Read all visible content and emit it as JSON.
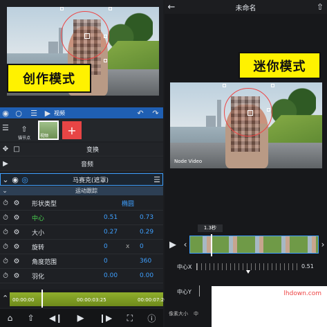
{
  "left": {
    "mode_label": "创作模式",
    "layer_bar": {
      "label": "视频"
    },
    "track": {
      "node_label": "锚节点",
      "clip_label": "视频",
      "add_label": "+"
    },
    "menu": {
      "transform": "变换",
      "audio": "音频"
    },
    "effect": {
      "title": "马赛克(遮罩)",
      "section": "运动跟踪"
    },
    "params": [
      {
        "name": "形状类型",
        "v1": "",
        "v2": "椭圆",
        "highlight": false
      },
      {
        "name": "中心",
        "v1": "0.51",
        "v2": "0.73",
        "highlight": true
      },
      {
        "name": "大小",
        "v1": "0.27",
        "v2": "0.29",
        "highlight": false
      },
      {
        "name": "旋转",
        "v1": "0",
        "mid": "x",
        "v2": "0",
        "highlight": false
      },
      {
        "name": "角度范围",
        "v1": "0",
        "v2": "360",
        "highlight": false
      },
      {
        "name": "羽化",
        "v1": "0.00",
        "v2": "0.00",
        "highlight": false
      }
    ],
    "timeline": {
      "t0": "00:00:00",
      "t1": "00:00:03:25",
      "t2": "00:00:07:20"
    }
  },
  "right": {
    "title": "未命名",
    "mode_label": "迷你模式",
    "watermark": "Node Video",
    "duration": "1.3秒",
    "center_x_label": "中心X",
    "center_x_value": "0.51",
    "center_x_level": 0.51,
    "center_y_label": "中心Y",
    "bottom_tabs": [
      "像素大小",
      "中"
    ],
    "site_watermark": "lhdown.com"
  }
}
